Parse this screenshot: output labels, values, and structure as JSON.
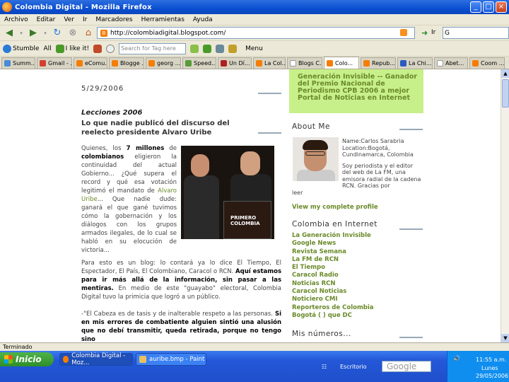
{
  "window": {
    "title": "Colombia Digital - Mozilla Firefox",
    "min": "_",
    "max": "□",
    "close": "×"
  },
  "menu": [
    "Archivo",
    "Editar",
    "Ver",
    "Ir",
    "Marcadores",
    "Herramientas",
    "Ayuda"
  ],
  "nav": {
    "url": "http://colombiadigital.blogspot.com/",
    "go_label": "Ir",
    "search_value": "G"
  },
  "toolbar2": {
    "stumble": "Stumble",
    "all": "All",
    "ilike": "I like it!",
    "search_placeholder": "Search for Tag here",
    "menu": "Menu"
  },
  "tabs": [
    "Summ..",
    "Gmail - ...",
    "eComu...",
    "Blogge ...",
    "georg ...",
    "Speed...",
    "Un Dí...",
    "La Col...",
    "Blogs C...",
    "Colo...",
    "Repub...",
    "La Chi...",
    "Abet...",
    "Coom ..."
  ],
  "post": {
    "date": "5/29/2006",
    "category": "Lecciones 2006",
    "title": "Lo que nadie publicó del discurso del reelecto presidente Alvaro Uribe",
    "para1_pre": "Quienes, los ",
    "para1_bold1": "7 millones",
    "para1_mid": " de ",
    "para1_bold2": "colombianos",
    "para1_text": " eligieron la continuidad del actual Gobierno... ¿Qué supera el record y qué esa votación legitimó el mandato de ",
    "para1_link": "Alvaro Uribe",
    "para1_end": "... Que nadie dude: ganará el que gané tuvimos cómo la gobernación y los diálogos con los grupos armados ilegales, de lo cual se habló en su elocución de victoria...",
    "photo_text": "PRIMERO COLOMBIA",
    "para2": "Para esto es un blog: lo contará ya lo dice El Tiempo, El Espectador, El País, El Colombiano, Caracol o RCN. ",
    "para2_bold": "Aquí estamos para ir más allá de la información, sin pasar a las mentiras.",
    "para2_end": " En medio de este \"guayabo\" electoral, Colombia Digital tuvo la primicia que logró a un público.",
    "para3": "-\"El Cabeza es de tasis y de inalterable respeto a las personas. ",
    "para3_bold": "Si en mis errores de combatiente alguien sintió una alusión que no debí transmitir, queda retirada, porque no tengo sino"
  },
  "sidebar": {
    "green_text": "Generación Invisible -- Ganador del Premio Nacional de Periodismo CPB 2006 a mejor Portal de Noticias en Internet",
    "about_heading": "About Me",
    "about_name": "Name:Carlos Sarabria",
    "about_location": "Location:Bogotá, Cundinamarca, Colombia",
    "about_bio": "Soy periodista y el editor del web de La FM, una emisora radial de la cadena RCN. Gracias por",
    "about_bio2": "leer",
    "profile_link": "View my complete profile",
    "colombia_heading": "Colombia en Internet",
    "links": [
      "La Generación Invisible",
      "Google News",
      "Revista Semana",
      "La FM de RCN",
      "El Tiempo",
      "Caracol Radio",
      "Noticias RCN",
      "Caracol Noticias",
      "Noticiero CMI",
      "Reporteros de Colombia",
      "Bogotá ( ) que DC"
    ],
    "numbers_heading": "Mis números..."
  },
  "status": {
    "text": "Terminado"
  },
  "taskbar": {
    "start": "Inicio",
    "tasks": [
      "Colombia Digital - Moz...",
      "auribe.bmp - Paint"
    ],
    "escritorio": "Escritorio",
    "google": "Google",
    "clock": "11:55 a.m.",
    "day": "Lunes",
    "date": "29/05/2006"
  }
}
